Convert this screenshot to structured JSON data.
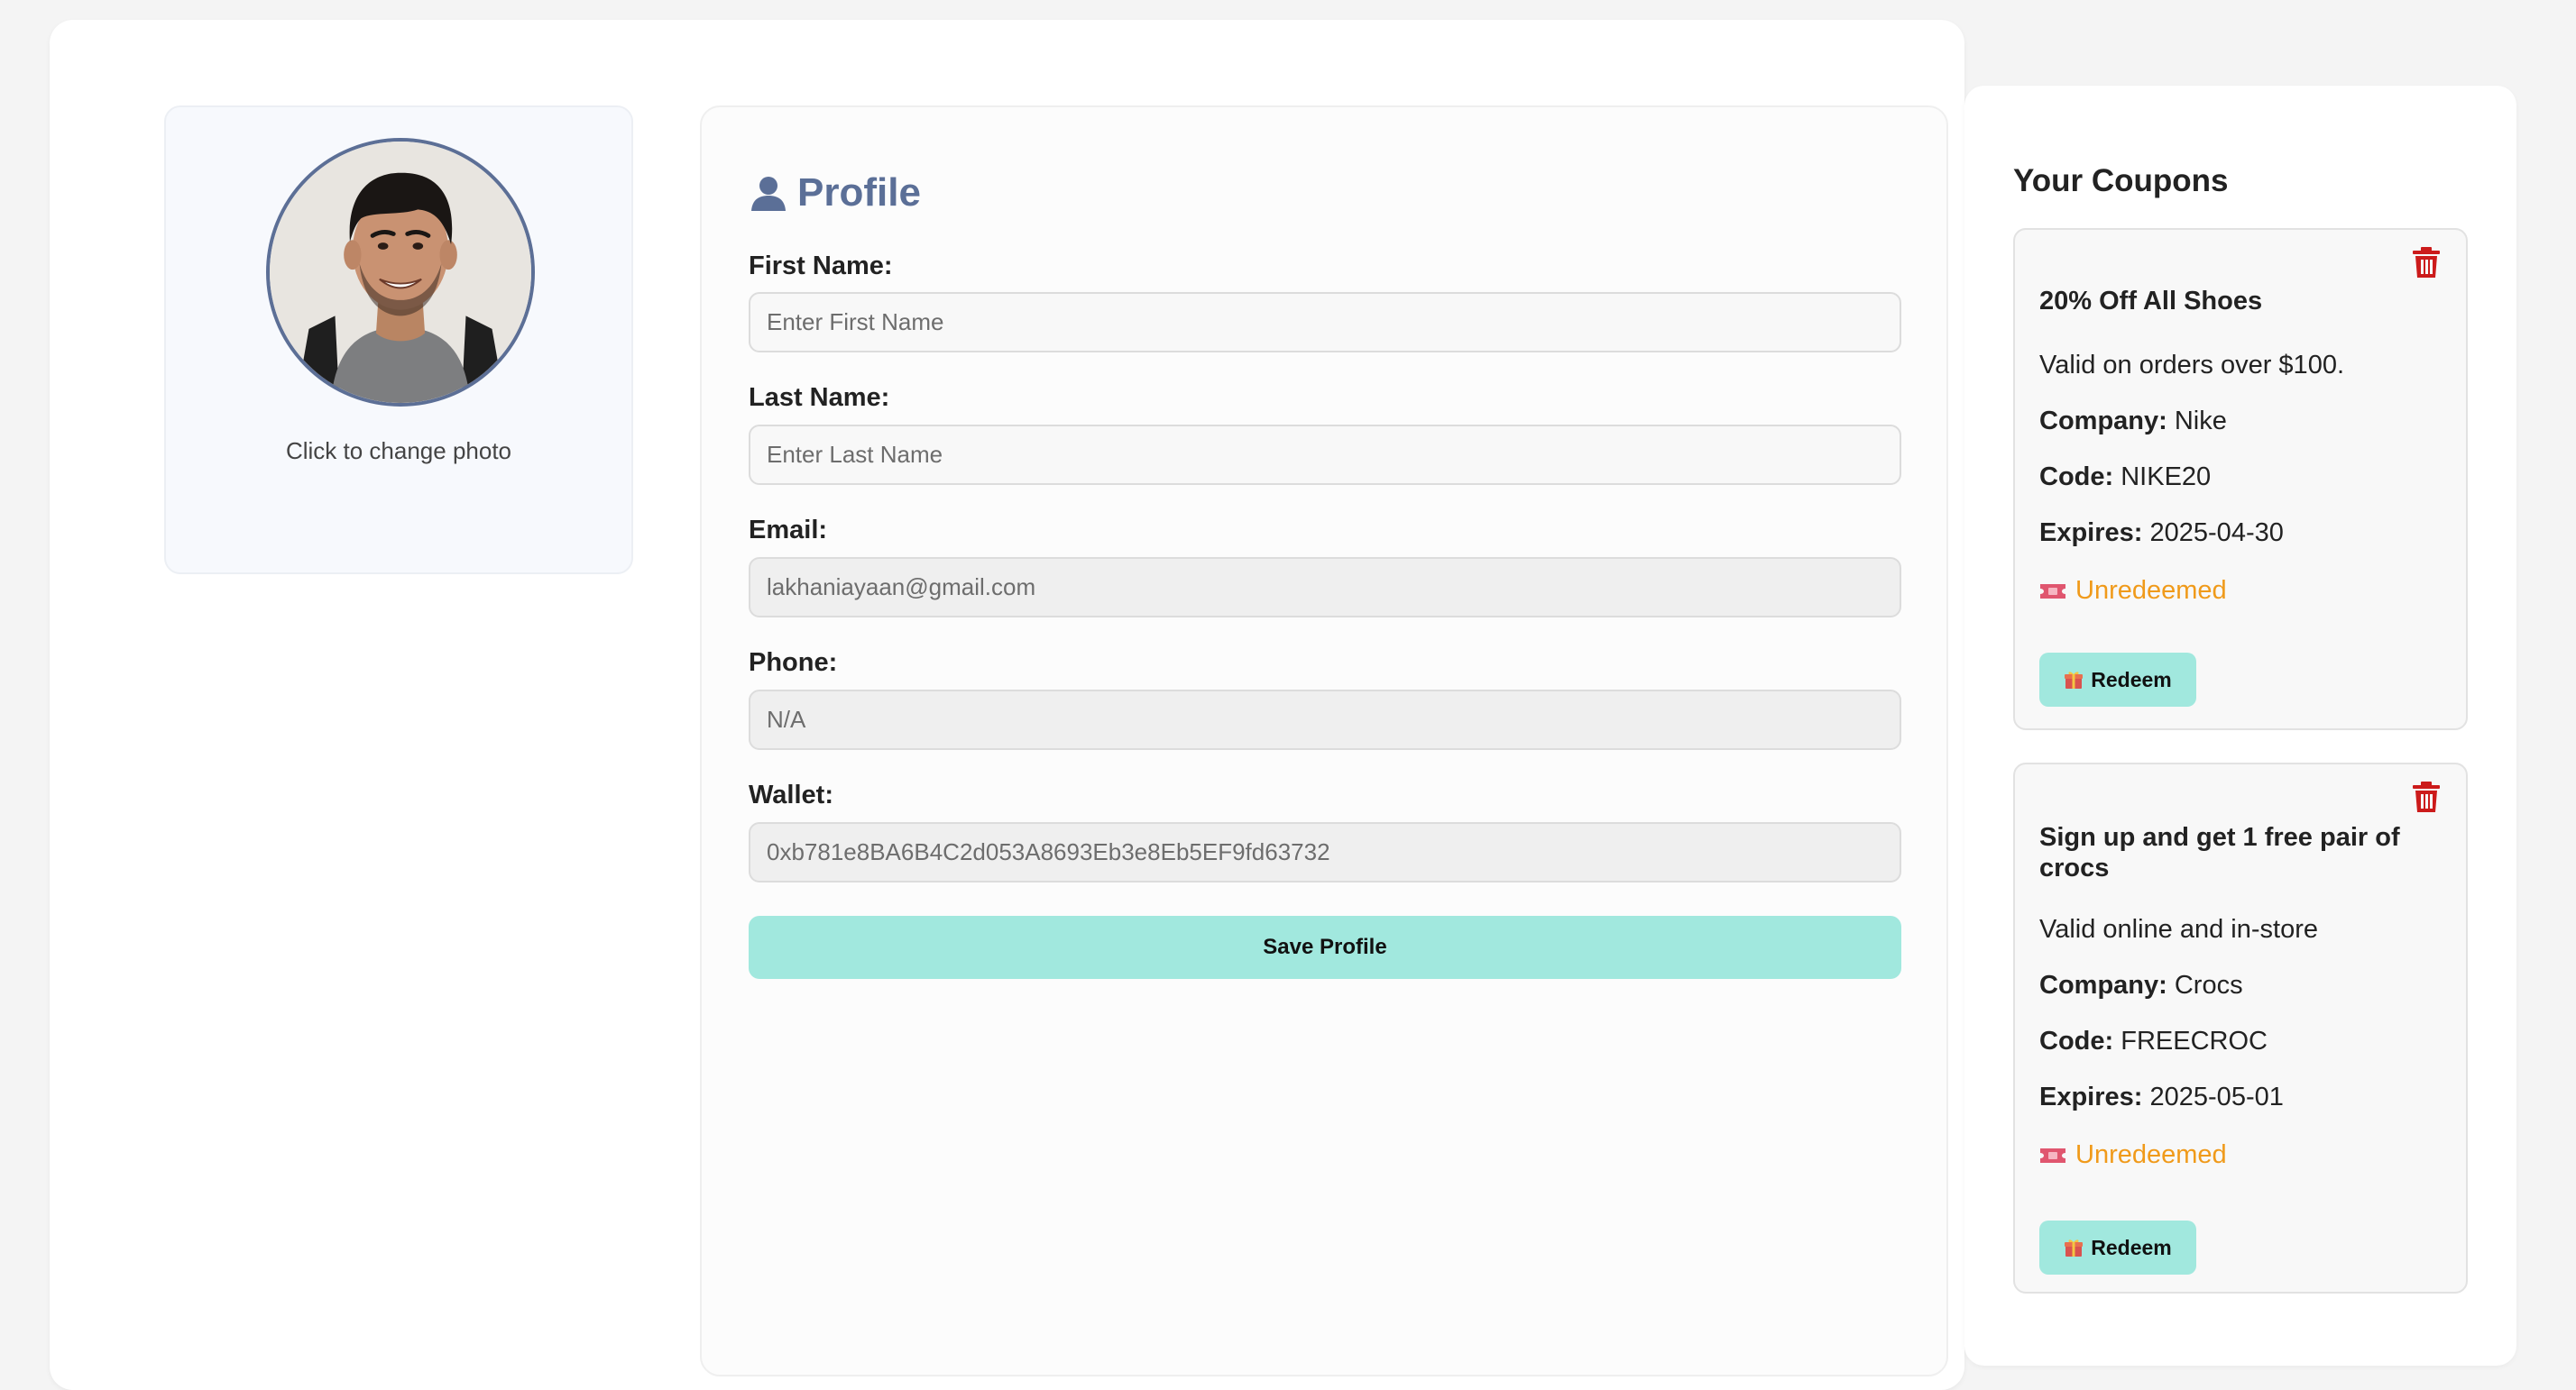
{
  "photo": {
    "caption": "Click to change photo"
  },
  "profile": {
    "icon": "user-icon",
    "title": "Profile",
    "fields": {
      "first_name": {
        "label": "First Name:",
        "placeholder": "Enter First Name",
        "value": ""
      },
      "last_name": {
        "label": "Last Name:",
        "placeholder": "Enter Last Name",
        "value": ""
      },
      "email": {
        "label": "Email:",
        "value": "lakhaniayaan@gmail.com"
      },
      "phone": {
        "label": "Phone:",
        "value": "N/A"
      },
      "wallet": {
        "label": "Wallet:",
        "value": "0xb781e8BA6B4C2d053A8693Eb3e8Eb5EF9fd63732"
      }
    },
    "save_label": "Save Profile"
  },
  "coupons": {
    "title": "Your Coupons",
    "items": [
      {
        "title": "20% Off All Shoes",
        "description": "Valid on orders over $100.",
        "company_label": "Company:",
        "company": "Nike",
        "code_label": "Code:",
        "code": "NIKE20",
        "expires_label": "Expires:",
        "expires": "2025-04-30",
        "status": "Unredeemed",
        "redeem_label": "Redeem"
      },
      {
        "title": "Sign up and get 1 free pair of crocs",
        "description": "Valid online and in-store",
        "company_label": "Company:",
        "company": "Crocs",
        "code_label": "Code:",
        "code": "FREECROC",
        "expires_label": "Expires:",
        "expires": "2025-05-01",
        "status": "Unredeemed",
        "redeem_label": "Redeem"
      }
    ]
  },
  "colors": {
    "accent": "#a1e8de",
    "title": "#5b6f97",
    "status_unredeemed": "#f09a1a",
    "delete": "#cc1b1b"
  }
}
